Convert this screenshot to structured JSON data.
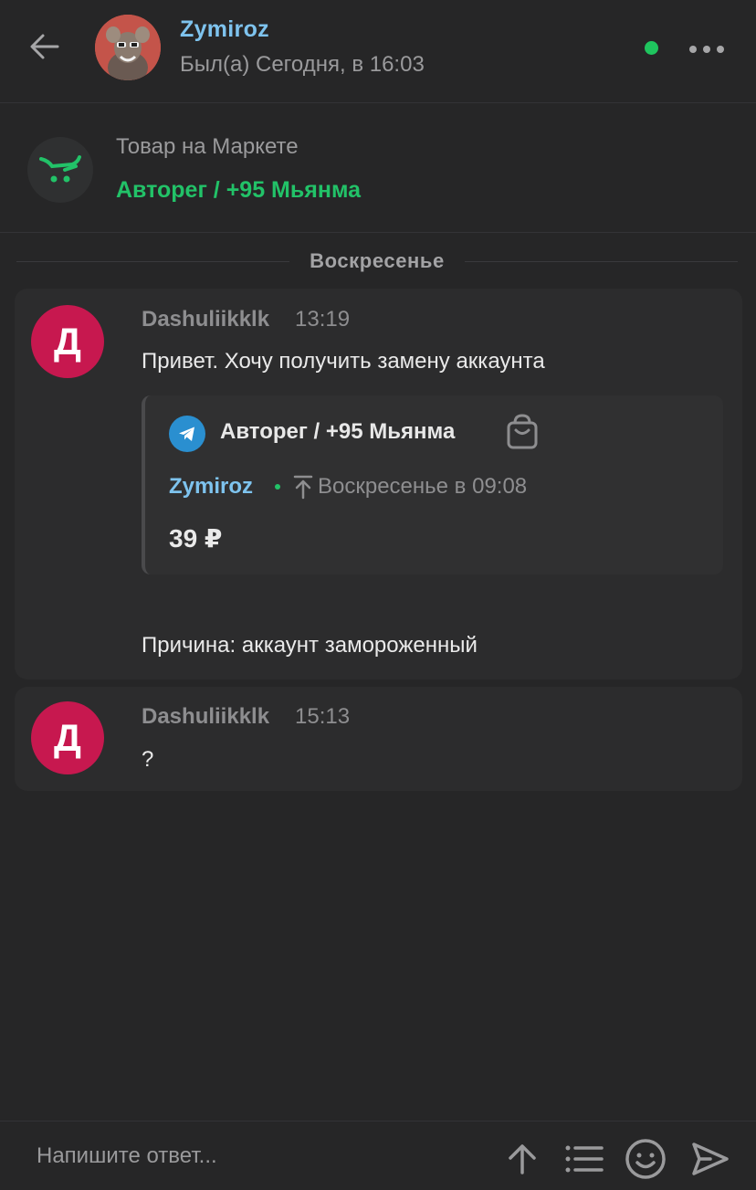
{
  "header": {
    "name": "Zymiroz",
    "status": "Был(а) Сегодня, в 16:03",
    "online_color": "#1fc45e"
  },
  "product": {
    "caption": "Товар на Маркете",
    "title": "Авторег / +95 Мьянма",
    "accent_color": "#22c268"
  },
  "date_divider": "Воскресенье",
  "messages": [
    {
      "avatar_letter": "Д",
      "author": "Dashuliikklk",
      "time": "13:19",
      "text": "Привет. Хочу получить замену аккаунта",
      "quote": {
        "title": "Авторег / +95 Мьянма",
        "seller": "Zymiroz",
        "date": "Воскресенье в 09:08",
        "price": "39 ₽"
      },
      "reason": "Причина: аккаунт замороженный"
    },
    {
      "avatar_letter": "Д",
      "author": "Dashuliikklk",
      "time": "15:13",
      "text": "?"
    }
  ],
  "composer": {
    "placeholder": "Напишите ответ..."
  },
  "icons": {
    "back": "arrow-left-icon",
    "more": "more-horizontal-icon",
    "market": "market-cart-icon",
    "telegram": "telegram-icon",
    "bag": "shopping-bag-icon",
    "raise": "raise-up-icon",
    "upload": "arrow-up-icon",
    "list": "list-icon",
    "emoji": "smile-icon",
    "send": "send-icon"
  }
}
